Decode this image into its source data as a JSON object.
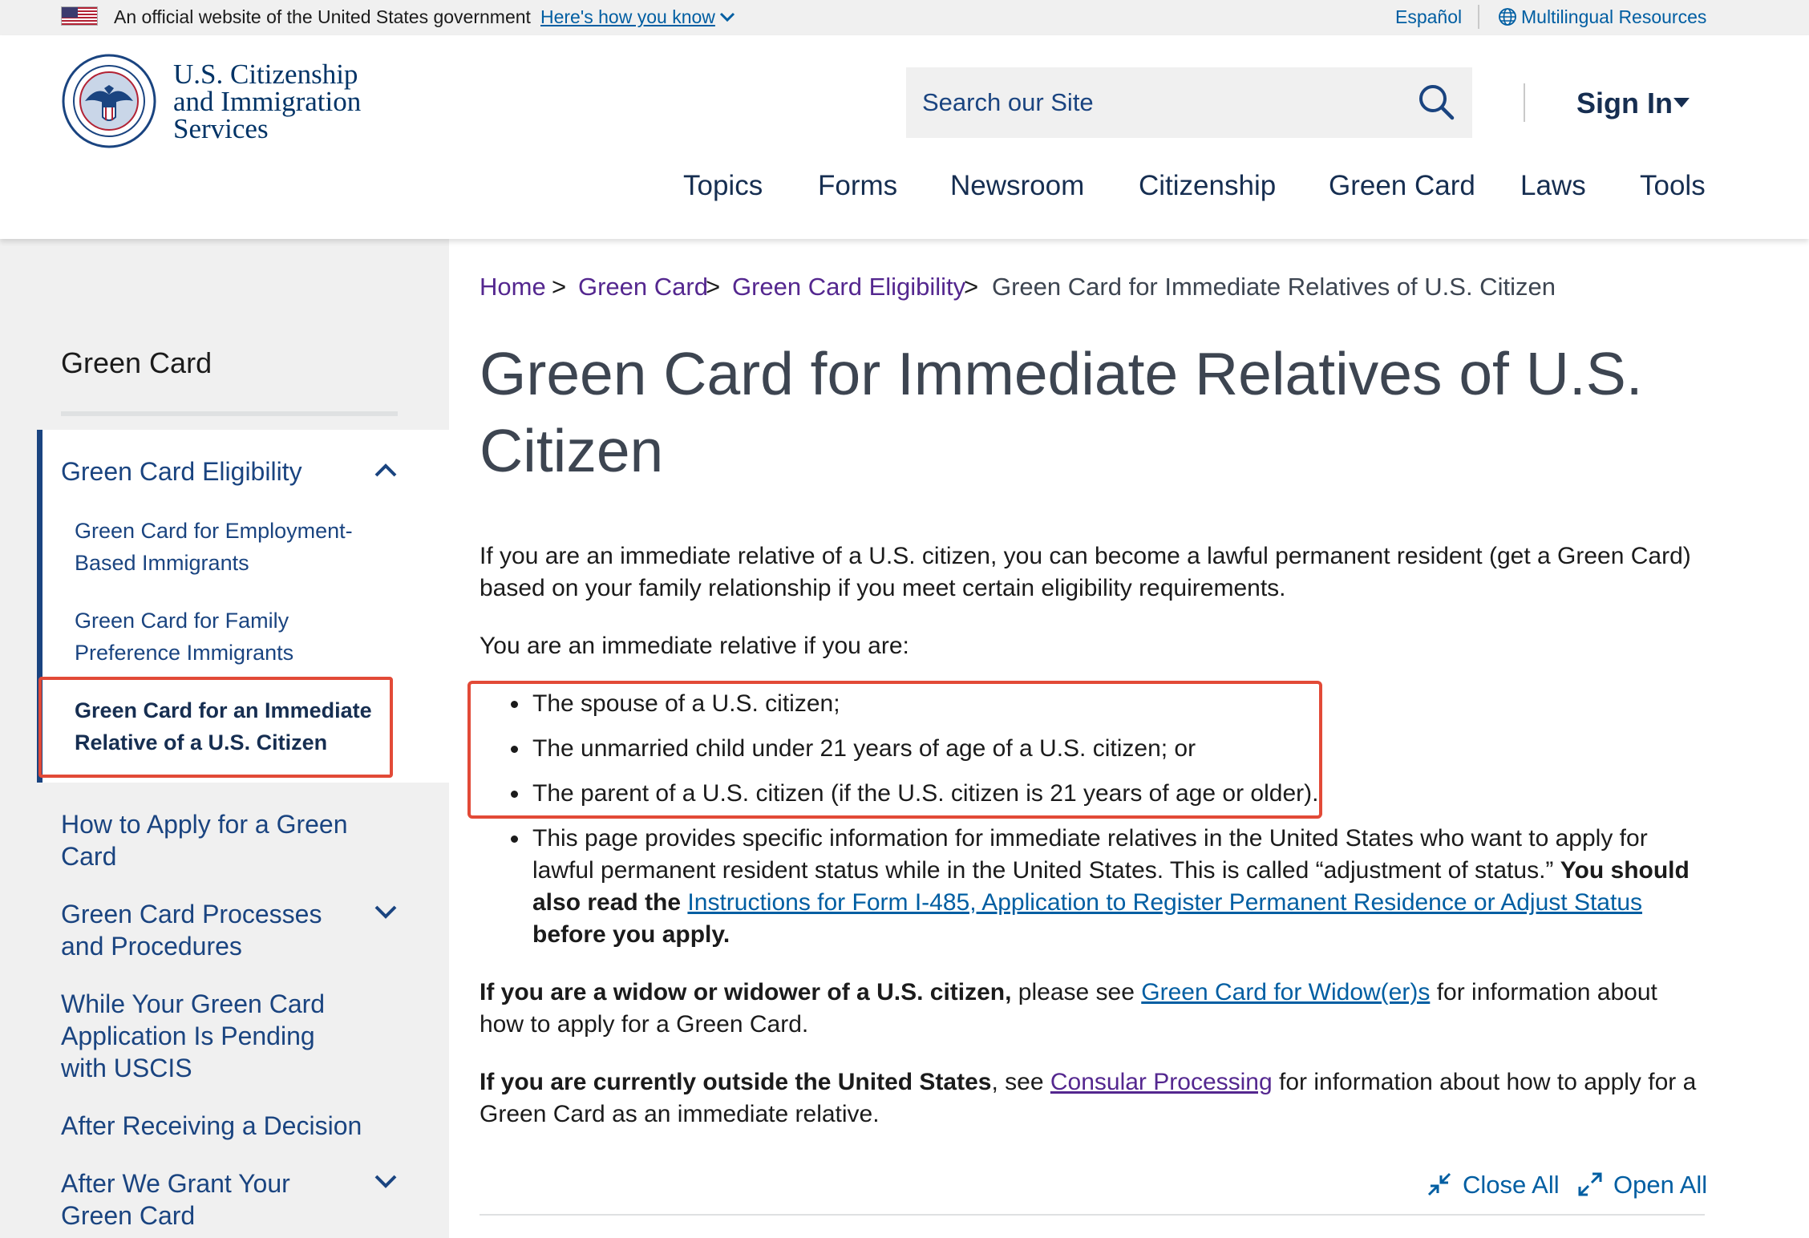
{
  "gov_banner": {
    "official_text": "An official website of the United States government",
    "how_you_know": "Here's how you know",
    "espanol": "Español",
    "multilingual": "Multilingual Resources"
  },
  "header": {
    "logo_line1": "U.S. Citizenship",
    "logo_line2": "and Immigration",
    "logo_line3": "Services",
    "search_placeholder": "Search our Site",
    "sign_in": "Sign In",
    "nav": [
      "Topics",
      "Forms",
      "Newsroom",
      "Citizenship",
      "Green Card",
      "Laws",
      "Tools"
    ]
  },
  "sidebar": {
    "title": "Green Card",
    "items": [
      {
        "label": "Green Card Eligibility",
        "expanded": true
      },
      {
        "label": "Green Card for Employment-Based Immigrants"
      },
      {
        "label": "Green Card for Family Preference Immigrants"
      },
      {
        "label": "Green Card for an Immediate Relative of a U.S. Citizen",
        "active": true
      },
      {
        "label": "How to Apply for a Green Card"
      },
      {
        "label": "Green Card Processes and Procedures",
        "expandable": true
      },
      {
        "label": "While Your Green Card Application Is Pending with USCIS"
      },
      {
        "label": "After Receiving a Decision"
      },
      {
        "label": "After We Grant Your Green Card",
        "expandable": true
      }
    ]
  },
  "breadcrumb": {
    "items": [
      "Home",
      "Green Card",
      "Green Card Eligibility"
    ],
    "separator": ">",
    "current": "Green Card for Immediate Relatives of U.S. Citizen"
  },
  "main": {
    "title": "Green Card for Immediate Relatives of U.S. Citizen",
    "intro": "If you are an immediate relative of a U.S. citizen, you can become a lawful permanent resident (get a Green Card) based on your family relationship if you meet certain eligibility requirements.",
    "list_intro": "You are an immediate relative if you are:",
    "bullets": [
      "The spouse of a U.S. citizen;",
      "The unmarried child under 21 years of age of a U.S. citizen; or",
      "The parent of a U.S. citizen (if the U.S. citizen is 21 years of age or older)."
    ],
    "bullet4_text1": "This page provides specific information for immediate relatives in the United States who want to apply for lawful permanent resident status while in the United States. This is called “adjustment of status.”",
    "bullet4_bold1": "You should also read the",
    "bullet4_link": "Instructions for Form I-485, Application to Register Permanent Residence or Adjust Status",
    "bullet4_bold2": "before you apply.",
    "widow_bold": "If you are a widow or widower of a U.S. citizen,",
    "widow_text1": "please see",
    "widow_link": "Green Card for Widow(er)s",
    "widow_text2": "for information about how to apply for a Green Card.",
    "outside_bold": "If you are currently outside the United States",
    "outside_text1": ", see",
    "outside_link": "Consular Processing",
    "outside_text2": "for information about how to apply for a Green Card as an immediate relative.",
    "close_all": "Close All",
    "open_all": "Open All"
  },
  "colors": {
    "link": "#005ea2",
    "visited": "#54278f",
    "navy": "#162e51",
    "annotation_red": "#e24a37"
  }
}
